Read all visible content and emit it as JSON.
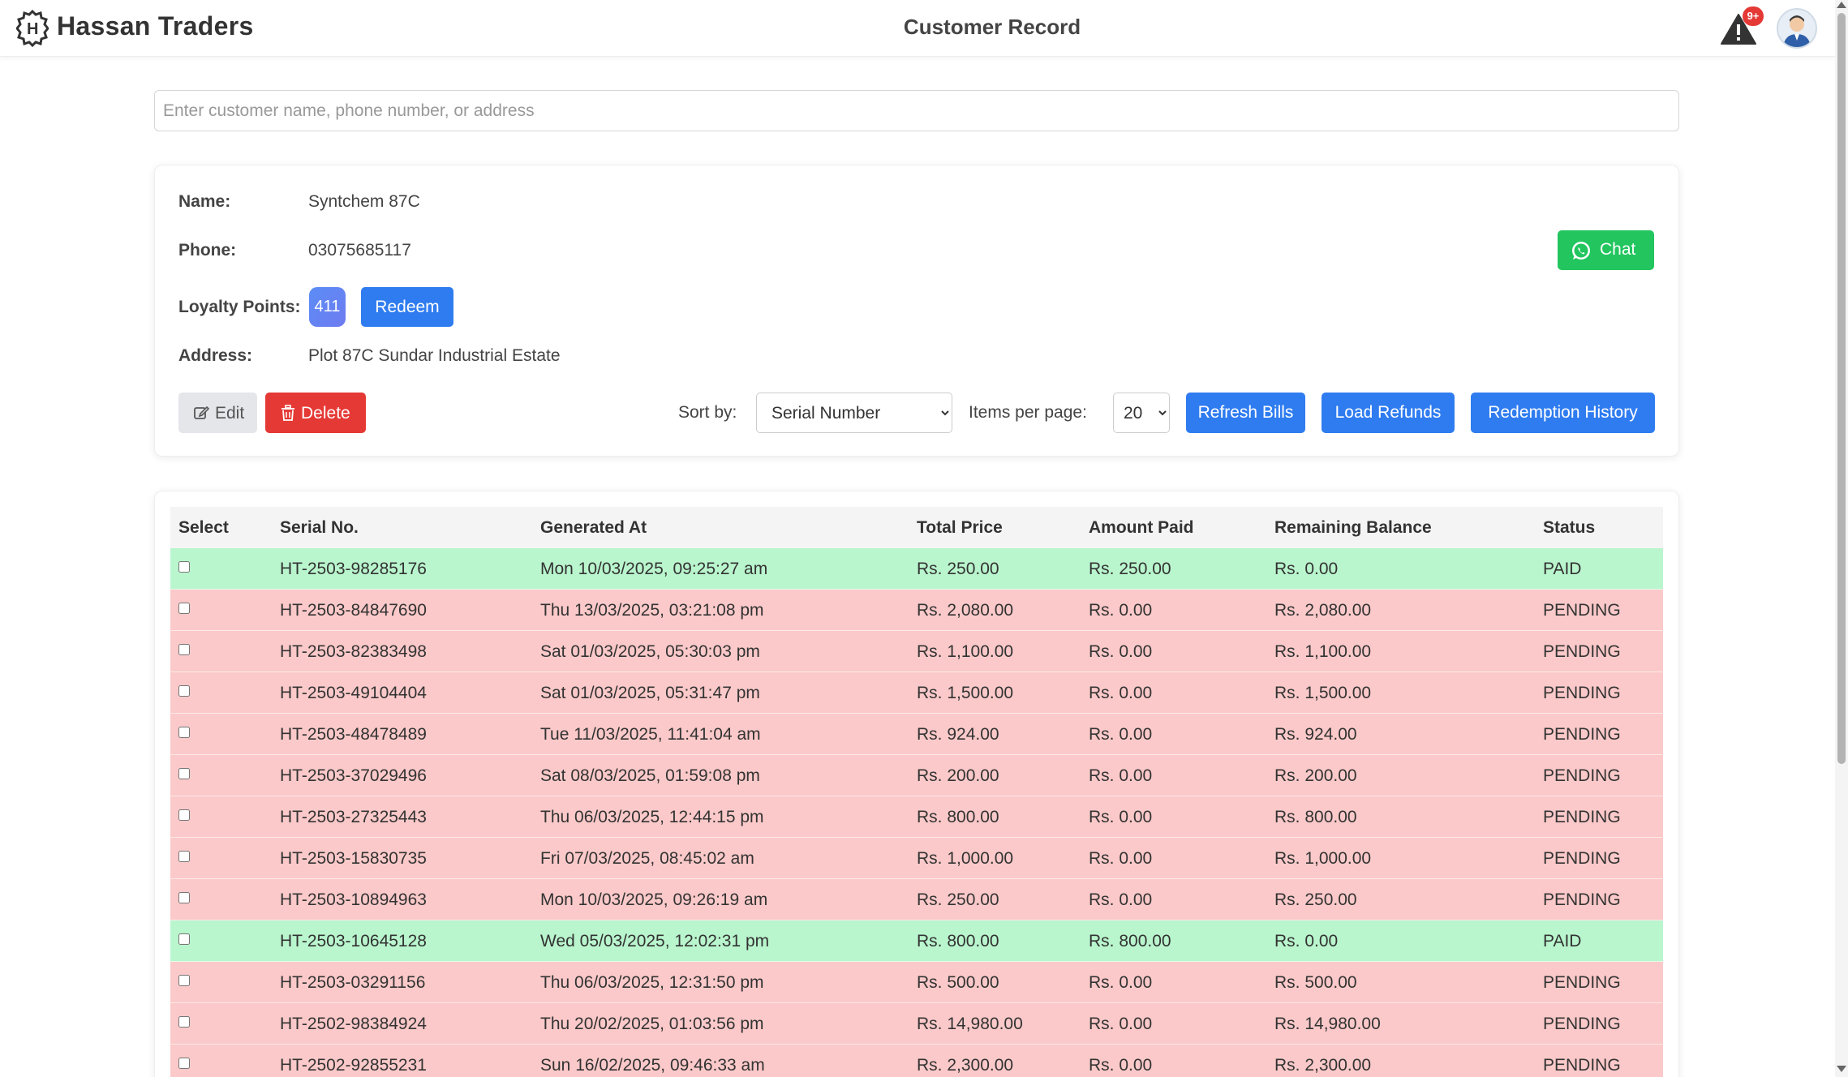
{
  "header": {
    "brand": "Hassan Traders",
    "title": "Customer Record",
    "notification_badge": "9+"
  },
  "search": {
    "placeholder": "Enter customer name, phone number, or address",
    "value": ""
  },
  "customer": {
    "name_label": "Name:",
    "name": "Syntchem 87C",
    "phone_label": "Phone:",
    "phone": "03075685117",
    "loyalty_label": "Loyalty Points:",
    "loyalty_points": "411",
    "redeem_label": "Redeem",
    "address_label": "Address:",
    "address": "Plot 87C Sundar Industrial Estate",
    "chat_label": "Chat"
  },
  "actions": {
    "edit_label": "Edit",
    "delete_label": "Delete",
    "sort_label": "Sort by:",
    "sort_value": "Serial Number",
    "items_label": "Items per page:",
    "items_value": "20",
    "refresh_label": "Refresh Bills",
    "refunds_label": "Load Refunds",
    "history_label": "Redemption History"
  },
  "table": {
    "headers": [
      "Select",
      "Serial No.",
      "Generated At",
      "Total Price",
      "Amount Paid",
      "Remaining Balance",
      "Status"
    ],
    "rows": [
      {
        "serial": "HT-2503-98285176",
        "generated": "Mon 10/03/2025, 09:25:27 am",
        "total": "Rs. 250.00",
        "paid": "Rs. 250.00",
        "remaining": "Rs. 0.00",
        "status": "PAID"
      },
      {
        "serial": "HT-2503-84847690",
        "generated": "Thu 13/03/2025, 03:21:08 pm",
        "total": "Rs. 2,080.00",
        "paid": "Rs. 0.00",
        "remaining": "Rs. 2,080.00",
        "status": "PENDING"
      },
      {
        "serial": "HT-2503-82383498",
        "generated": "Sat 01/03/2025, 05:30:03 pm",
        "total": "Rs. 1,100.00",
        "paid": "Rs. 0.00",
        "remaining": "Rs. 1,100.00",
        "status": "PENDING"
      },
      {
        "serial": "HT-2503-49104404",
        "generated": "Sat 01/03/2025, 05:31:47 pm",
        "total": "Rs. 1,500.00",
        "paid": "Rs. 0.00",
        "remaining": "Rs. 1,500.00",
        "status": "PENDING"
      },
      {
        "serial": "HT-2503-48478489",
        "generated": "Tue 11/03/2025, 11:41:04 am",
        "total": "Rs. 924.00",
        "paid": "Rs. 0.00",
        "remaining": "Rs. 924.00",
        "status": "PENDING"
      },
      {
        "serial": "HT-2503-37029496",
        "generated": "Sat 08/03/2025, 01:59:08 pm",
        "total": "Rs. 200.00",
        "paid": "Rs. 0.00",
        "remaining": "Rs. 200.00",
        "status": "PENDING"
      },
      {
        "serial": "HT-2503-27325443",
        "generated": "Thu 06/03/2025, 12:44:15 pm",
        "total": "Rs. 800.00",
        "paid": "Rs. 0.00",
        "remaining": "Rs. 800.00",
        "status": "PENDING"
      },
      {
        "serial": "HT-2503-15830735",
        "generated": "Fri 07/03/2025, 08:45:02 am",
        "total": "Rs. 1,000.00",
        "paid": "Rs. 0.00",
        "remaining": "Rs. 1,000.00",
        "status": "PENDING"
      },
      {
        "serial": "HT-2503-10894963",
        "generated": "Mon 10/03/2025, 09:26:19 am",
        "total": "Rs. 250.00",
        "paid": "Rs. 0.00",
        "remaining": "Rs. 250.00",
        "status": "PENDING"
      },
      {
        "serial": "HT-2503-10645128",
        "generated": "Wed 05/03/2025, 12:02:31 pm",
        "total": "Rs. 800.00",
        "paid": "Rs. 800.00",
        "remaining": "Rs. 0.00",
        "status": "PAID"
      },
      {
        "serial": "HT-2503-03291156",
        "generated": "Thu 06/03/2025, 12:31:50 pm",
        "total": "Rs. 500.00",
        "paid": "Rs. 0.00",
        "remaining": "Rs. 500.00",
        "status": "PENDING"
      },
      {
        "serial": "HT-2502-98384924",
        "generated": "Thu 20/02/2025, 01:03:56 pm",
        "total": "Rs. 14,980.00",
        "paid": "Rs. 0.00",
        "remaining": "Rs. 14,980.00",
        "status": "PENDING"
      },
      {
        "serial": "HT-2502-92855231",
        "generated": "Sun 16/02/2025, 09:46:33 am",
        "total": "Rs. 2,300.00",
        "paid": "Rs. 0.00",
        "remaining": "Rs. 2,300.00",
        "status": "PENDING"
      }
    ]
  },
  "colors": {
    "paid_row": "#b9f5cd",
    "pending_row": "#fbc9c9",
    "primary": "#2f7cf0",
    "danger": "#e53935",
    "chat": "#22c55e"
  },
  "icons": {
    "logo": "gear-h-logo-icon",
    "alert": "warning-triangle-icon",
    "avatar": "user-avatar-icon",
    "chat": "whatsapp-icon",
    "edit": "edit-icon",
    "delete": "trash-icon"
  }
}
